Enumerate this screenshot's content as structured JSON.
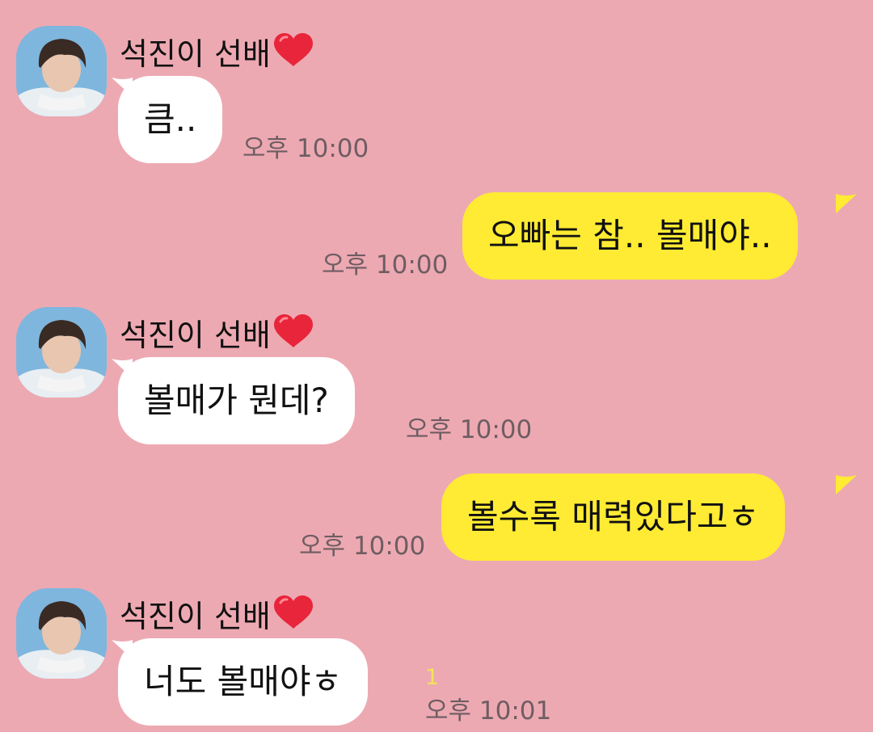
{
  "sender_name": "석진이 선배",
  "colors": {
    "background": "#eda9b2",
    "incoming_bubble": "#ffffff",
    "outgoing_bubble": "#ffeb33",
    "timestamp": "#6e5d62",
    "unread_count": "#f3e25a",
    "heart": "#e8253a"
  },
  "messages": [
    {
      "direction": "incoming",
      "text": "큼..",
      "time": "오후 10:00"
    },
    {
      "direction": "outgoing",
      "text": "오빠는 참.. 볼매야..",
      "time": "오후 10:00"
    },
    {
      "direction": "incoming",
      "text": "볼매가 뭔데?",
      "time": "오후 10:00"
    },
    {
      "direction": "outgoing",
      "text": "볼수록 매력있다고ㅎ",
      "time": "오후 10:00"
    },
    {
      "direction": "incoming",
      "text": "너도 볼매야ㅎ",
      "time": "오후 10:01",
      "unread": "1"
    }
  ]
}
